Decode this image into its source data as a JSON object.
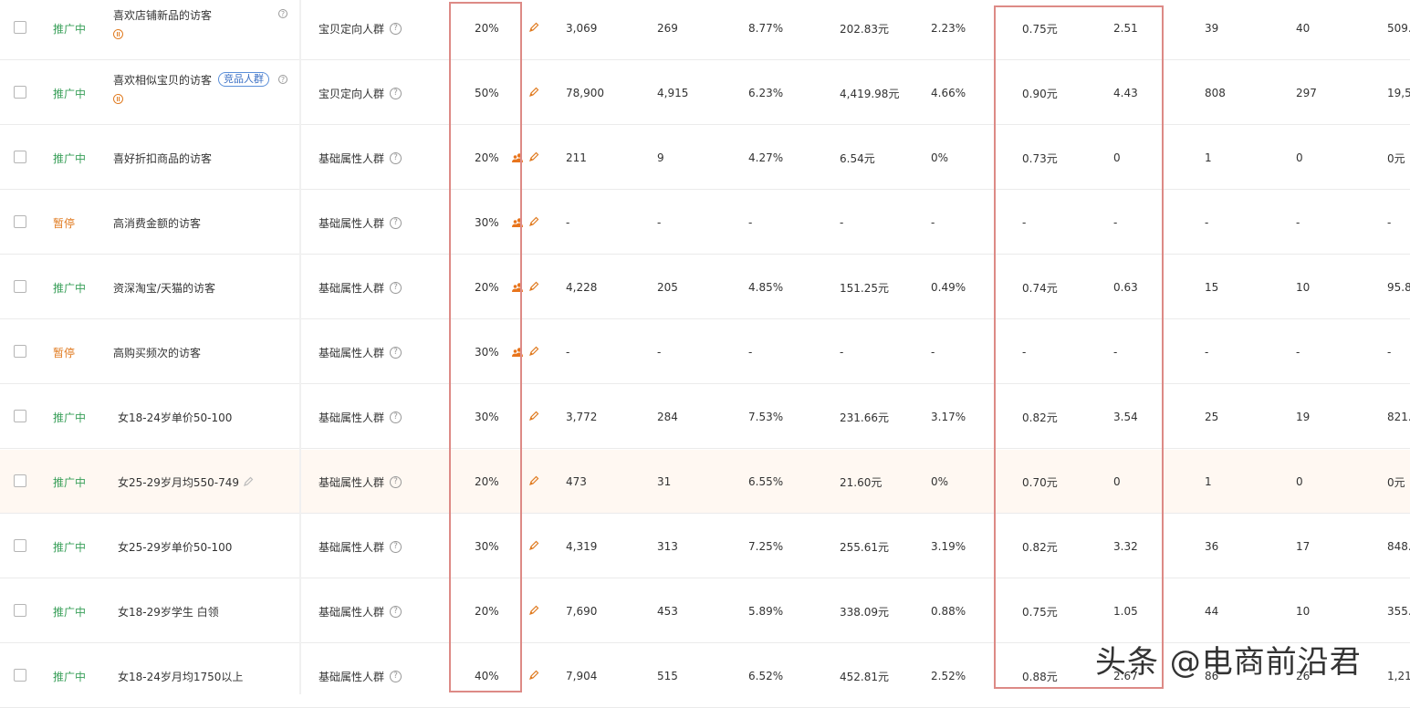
{
  "rows": [
    {
      "status": "推广中",
      "status_type": "on",
      "name": "喜欢店铺新品的访客",
      "tag": "",
      "pause_icon": true,
      "name_help": true,
      "type": "宝贝定向人群",
      "premium": "20%",
      "crowd_icon": false,
      "vals": [
        "3,069",
        "269",
        "8.77%",
        "202.83元",
        "2.23%",
        "0.75元",
        "2.51",
        "39",
        "40",
        "509."
      ]
    },
    {
      "status": "推广中",
      "status_type": "on",
      "name": "喜欢相似宝贝的访客",
      "tag": "竞品人群",
      "pause_icon": true,
      "name_help": true,
      "type": "宝贝定向人群",
      "premium": "50%",
      "crowd_icon": false,
      "vals": [
        "78,900",
        "4,915",
        "6.23%",
        "4,419.98元",
        "4.66%",
        "0.90元",
        "4.43",
        "808",
        "297",
        "19,5"
      ]
    },
    {
      "status": "推广中",
      "status_type": "on",
      "name": "喜好折扣商品的访客",
      "tag": "",
      "pause_icon": false,
      "name_help": false,
      "type": "基础属性人群",
      "premium": "20%",
      "crowd_icon": true,
      "vals": [
        "211",
        "9",
        "4.27%",
        "6.54元",
        "0%",
        "0.73元",
        "0",
        "1",
        "0",
        "0元"
      ]
    },
    {
      "status": "暂停",
      "status_type": "off",
      "name": "高消费金额的访客",
      "tag": "",
      "pause_icon": false,
      "name_help": false,
      "type": "基础属性人群",
      "premium": "30%",
      "crowd_icon": true,
      "vals": [
        "-",
        "-",
        "-",
        "-",
        "-",
        "-",
        "-",
        "-",
        "-",
        "-"
      ]
    },
    {
      "status": "推广中",
      "status_type": "on",
      "name": "资深淘宝/天猫的访客",
      "tag": "",
      "pause_icon": false,
      "name_help": false,
      "type": "基础属性人群",
      "premium": "20%",
      "crowd_icon": true,
      "vals": [
        "4,228",
        "205",
        "4.85%",
        "151.25元",
        "0.49%",
        "0.74元",
        "0.63",
        "15",
        "10",
        "95.8"
      ]
    },
    {
      "status": "暂停",
      "status_type": "off",
      "name": "高购买频次的访客",
      "tag": "",
      "pause_icon": false,
      "name_help": false,
      "type": "基础属性人群",
      "premium": "30%",
      "crowd_icon": true,
      "vals": [
        "-",
        "-",
        "-",
        "-",
        "-",
        "-",
        "-",
        "-",
        "-",
        "-"
      ]
    },
    {
      "status": "推广中",
      "status_type": "on",
      "name": "女18-24岁单价50-100",
      "tag": "",
      "pause_icon": false,
      "name_help": false,
      "type": "基础属性人群",
      "premium": "30%",
      "crowd_icon": false,
      "vals": [
        "3,772",
        "284",
        "7.53%",
        "231.66元",
        "3.17%",
        "0.82元",
        "3.54",
        "25",
        "19",
        "821."
      ]
    },
    {
      "status": "推广中",
      "status_type": "on",
      "name": "女25-29岁月均550-749",
      "tag": "",
      "pause_icon": false,
      "name_help": false,
      "edit_name": true,
      "type": "基础属性人群",
      "premium": "20%",
      "crowd_icon": false,
      "highlight": true,
      "vals": [
        "473",
        "31",
        "6.55%",
        "21.60元",
        "0%",
        "0.70元",
        "0",
        "1",
        "0",
        "0元"
      ]
    },
    {
      "status": "推广中",
      "status_type": "on",
      "name": "女25-29岁单价50-100",
      "tag": "",
      "pause_icon": false,
      "name_help": false,
      "type": "基础属性人群",
      "premium": "30%",
      "crowd_icon": false,
      "vals": [
        "4,319",
        "313",
        "7.25%",
        "255.61元",
        "3.19%",
        "0.82元",
        "3.32",
        "36",
        "17",
        "848."
      ]
    },
    {
      "status": "推广中",
      "status_type": "on",
      "name": "女18-29岁学生 白领",
      "tag": "",
      "pause_icon": false,
      "name_help": false,
      "type": "基础属性人群",
      "premium": "20%",
      "crowd_icon": false,
      "vals": [
        "7,690",
        "453",
        "5.89%",
        "338.09元",
        "0.88%",
        "0.75元",
        "1.05",
        "44",
        "10",
        "355."
      ]
    },
    {
      "status": "推广中",
      "status_type": "on",
      "name": "女18-24岁月均1750以上",
      "tag": "",
      "pause_icon": false,
      "name_help": false,
      "type": "基础属性人群",
      "premium": "40%",
      "crowd_icon": false,
      "vals": [
        "7,904",
        "515",
        "6.52%",
        "452.81元",
        "2.52%",
        "0.88元",
        "2.67",
        "86",
        "26",
        "1,21"
      ]
    }
  ],
  "watermark": "头条 @电商前沿君",
  "colors": {
    "active": "#3aa05a",
    "paused": "#e07b21",
    "highlight_box": "#dd8a86",
    "edit_icon": "#e07b21"
  }
}
